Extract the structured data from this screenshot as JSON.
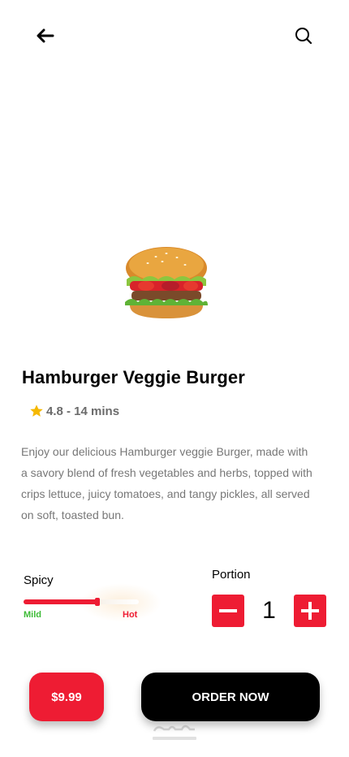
{
  "header": {
    "back_icon": "arrow-left-icon",
    "search_icon": "search-icon"
  },
  "product": {
    "name": "Hamburger Veggie Burger",
    "rating_text": "4.8 - 14 mins",
    "description": "Enjoy our delicious Hamburger veggie Burger, made with a savory blend of fresh vegetables and herbs, topped with crips lettuce, juicy tomatoes, and tangy pickles, all served on soft, toasted bun."
  },
  "spicy": {
    "label": "Spicy",
    "min_label": "Mild",
    "max_label": "Hot",
    "level": 0.64
  },
  "portion": {
    "label": "Portion",
    "quantity": "1"
  },
  "footer": {
    "price": "$9.99",
    "order_label": "ORDER NOW"
  },
  "colors": {
    "accent": "#ee1c33",
    "mild": "#3dbb36",
    "dark": "#000000",
    "star": "#f5b800"
  }
}
